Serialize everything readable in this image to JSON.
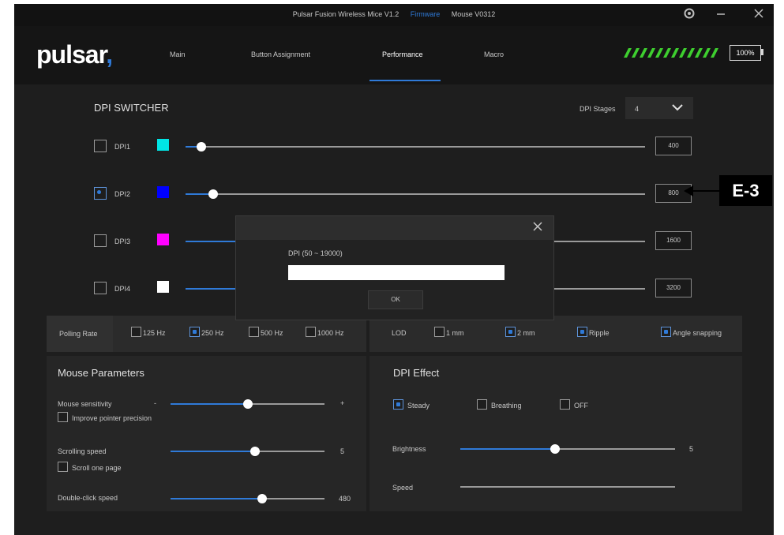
{
  "titlebar": {
    "app_title": "Pulsar Fusion Wireless Mice V1.2",
    "firmware_link": "Firmware",
    "mouse_version": "Mouse V0312"
  },
  "nav": {
    "logo": "pulsar",
    "tabs": [
      "Main",
      "Button Assignment",
      "Performance",
      "Macro"
    ],
    "active_tab": "Performance",
    "battery": "100%"
  },
  "dpi_switcher": {
    "title": "DPI SWITCHER",
    "stages_label": "DPI Stages",
    "stages_value": "4",
    "rows": [
      {
        "label": "DPI1",
        "color": "#00e5e5",
        "value": "400",
        "checked": false
      },
      {
        "label": "DPI2",
        "color": "#0000ff",
        "value": "800",
        "checked": true
      },
      {
        "label": "DPI3",
        "color": "#ff00ff",
        "value": "1600",
        "checked": false
      },
      {
        "label": "DPI4",
        "color": "#ffffff",
        "value": "3200",
        "checked": false
      }
    ]
  },
  "dialog": {
    "label": "DPI  (50 ~ 19000)",
    "input_value": "",
    "ok": "OK"
  },
  "polling": {
    "label": "Polling Rate",
    "options": [
      "125 Hz",
      "250 Hz",
      "500 Hz",
      "1000 Hz"
    ],
    "selected": "250 Hz"
  },
  "lod": {
    "label": "LOD",
    "options": [
      "1 mm",
      "2 mm"
    ],
    "selected": "2 mm",
    "ripple": "Ripple",
    "angle": "Angle snapping"
  },
  "mouse_params": {
    "title": "Mouse Parameters",
    "sensitivity_label": "Mouse sensitivity",
    "minus": "-",
    "plus": "+",
    "pointer_precision": "Improve pointer precision",
    "scroll_label": "Scrolling speed",
    "scroll_value": "5",
    "scroll_one_page": "Scroll one page",
    "double_click_label": "Double-click speed",
    "double_click_value": "480"
  },
  "dpi_effect": {
    "title": "DPI Effect",
    "options": [
      "Steady",
      "Breathing",
      "OFF"
    ],
    "selected": "Steady",
    "brightness_label": "Brightness",
    "brightness_value": "5",
    "speed_label": "Speed"
  },
  "annotation": {
    "label": "E-3"
  },
  "colors": {
    "accent": "#2f7ad8",
    "battery_green": "#3ecf2f"
  }
}
